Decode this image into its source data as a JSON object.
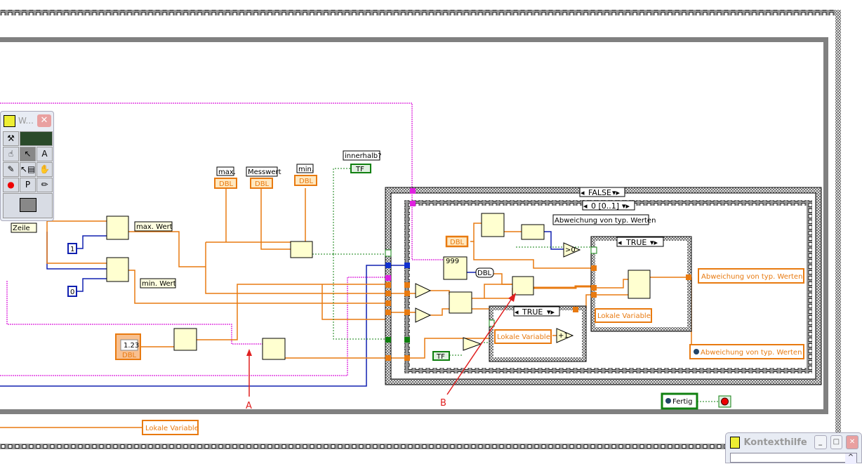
{
  "palette": {
    "title": "W...",
    "close": "✕",
    "tools": [
      "⚒",
      "▭",
      "☝",
      "↖",
      "A",
      "✎",
      "↖▤",
      "✋",
      "●",
      "P",
      "✏"
    ]
  },
  "context_help": {
    "title": "Kontexthilfe",
    "minimize": "_",
    "maximize": "□",
    "close": "✕",
    "scroll_up": "^"
  },
  "case_outer": {
    "selector": "FALSE"
  },
  "sequence": {
    "selector": "0 [0..1]"
  },
  "case_inner": {
    "selector": "TRUE"
  },
  "case_small": {
    "selector": "TRUE"
  },
  "labels": {
    "zeile": "Zeile",
    "max_wert": "max. Wert",
    "min_wert": "min. Wert",
    "const_1": "1",
    "const_0": "0",
    "max": "max.",
    "messwert": "Messwert",
    "min": "min.",
    "innerhalb": "innerhalb?",
    "abweichung_label": "Abweichung von typ. Werten",
    "num_const": "1.23",
    "dbl": "DBL",
    "tf": "TF",
    "fertig": "Fertig",
    "increment": "+1",
    "gt0": ">0",
    "array_const": "999"
  },
  "local_variables": {
    "abweichung_1": "Abweichung von typ. Werten",
    "lokale_1": "Lokale Variable",
    "lokale_2": "Lokale Variable",
    "abweichung_2": "Abweichung von typ. Werten",
    "lokale_bottom": "Lokale Variable"
  },
  "annotations": {
    "a": "A",
    "b": "B",
    "color": "#e02020"
  },
  "colors": {
    "orange_wire": "#e87a10",
    "pink_wire": "#e040e0",
    "blue_wire": "#1020b0",
    "green_wire": "#108010",
    "loop_gray": "#808080"
  }
}
